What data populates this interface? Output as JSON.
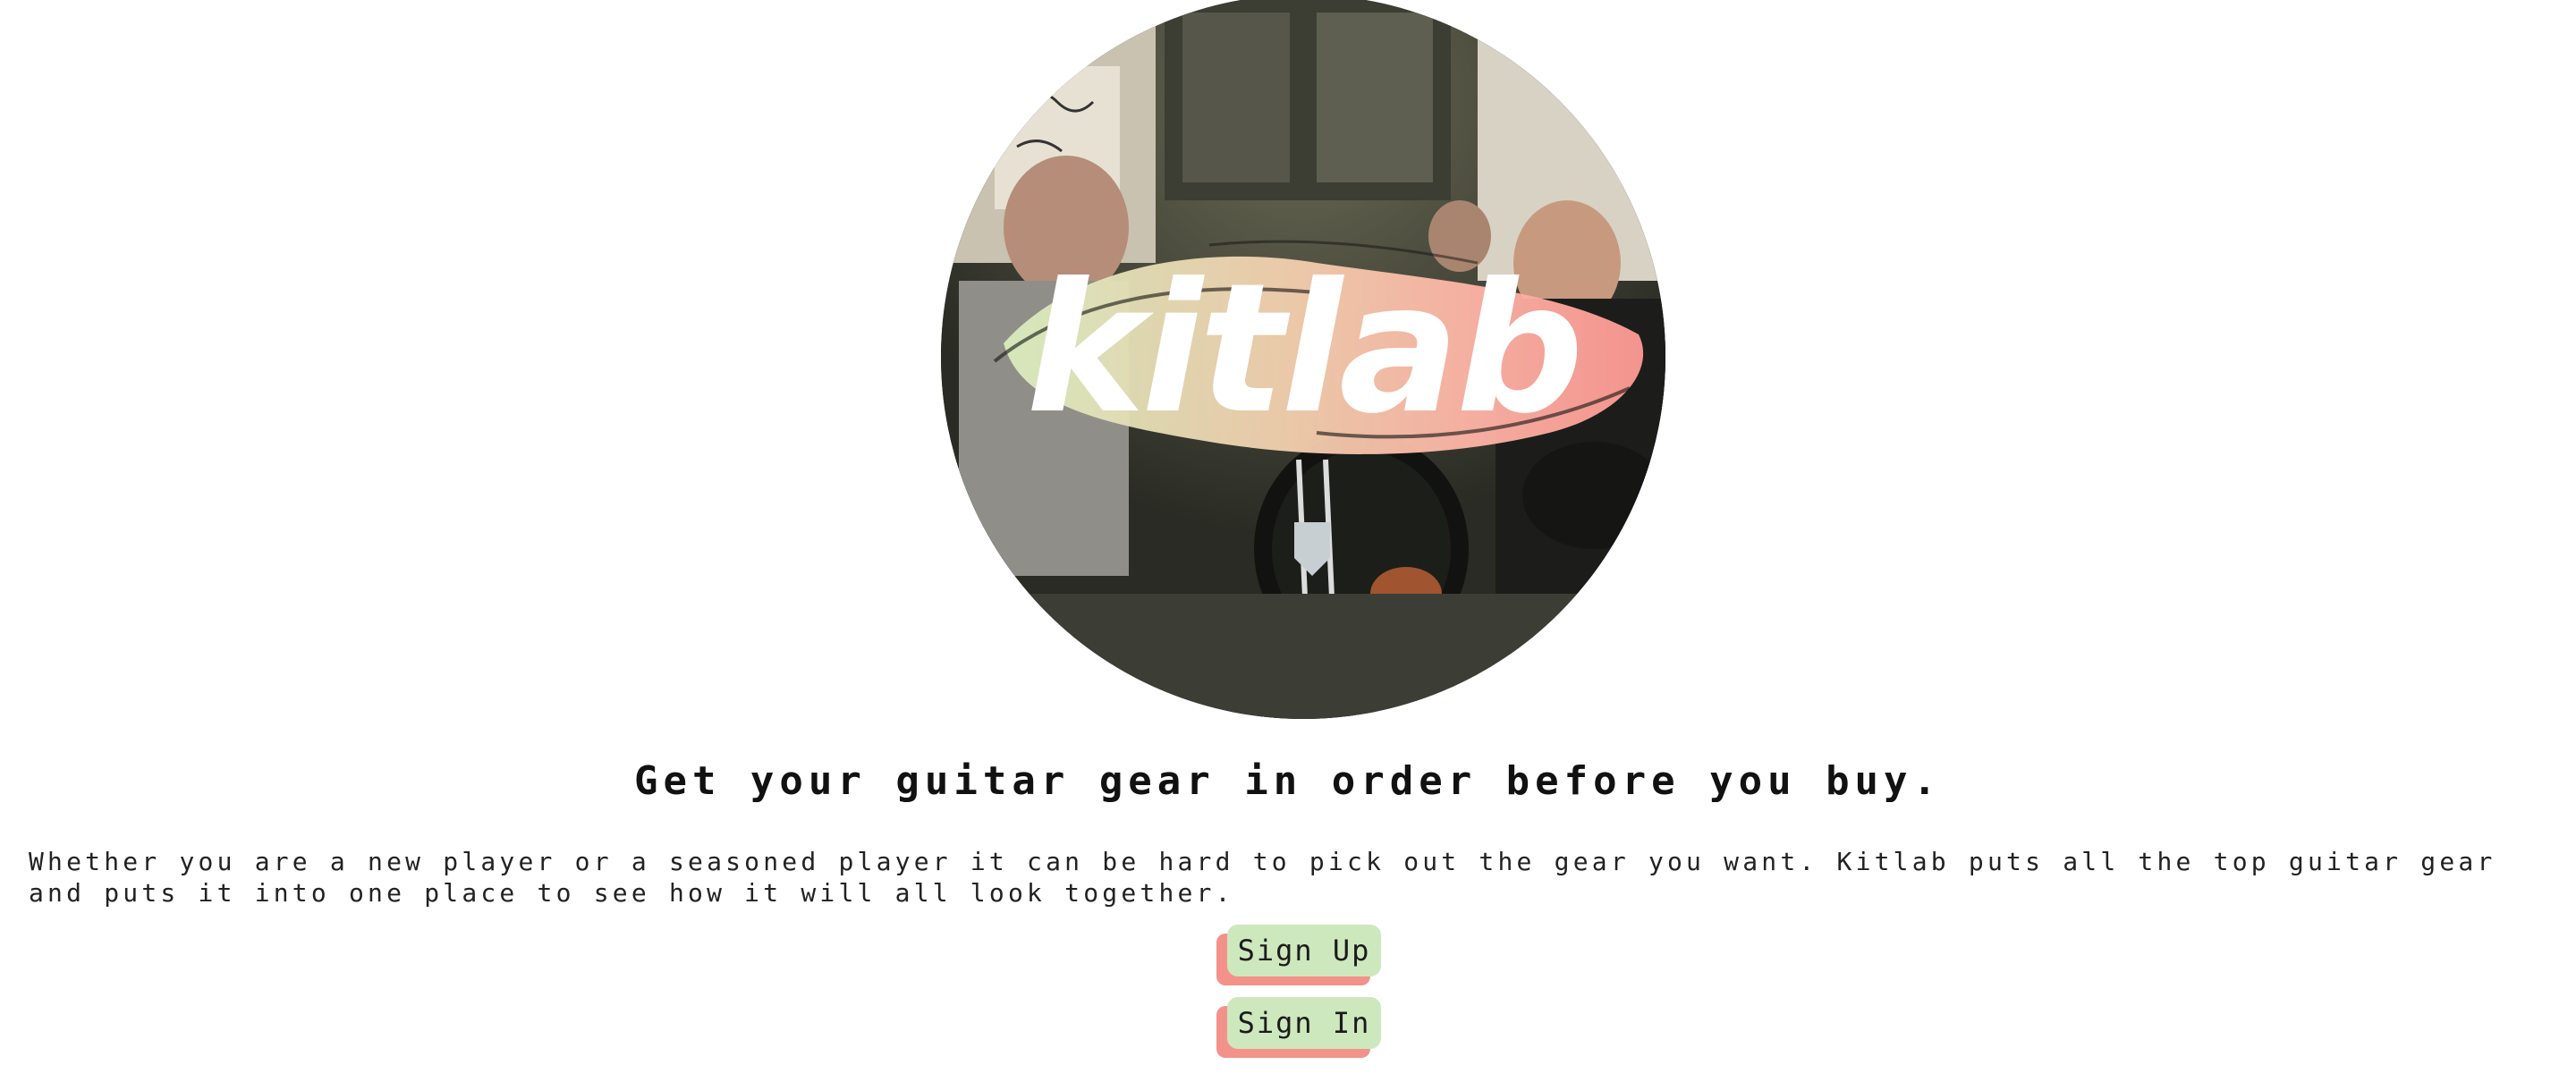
{
  "hero": {
    "logo_text": "kitlab",
    "image_label": "band-photo-logo"
  },
  "headline": "Get your guitar gear in order before you buy.",
  "description": "Whether you are a new player or a seasoned player it can be hard to pick out the gear you want. Kitlab puts all the top guitar gear and puts it into one place to see how it will all look together.",
  "buttons": {
    "sign_up": "Sign Up",
    "sign_in": "Sign In"
  },
  "colors": {
    "button_fill": "#cde8bd",
    "button_shadow": "#f2928a",
    "brush_pink": "#ff9a94",
    "brush_peach": "#f3cfae",
    "brush_green": "#d9ecbd"
  }
}
